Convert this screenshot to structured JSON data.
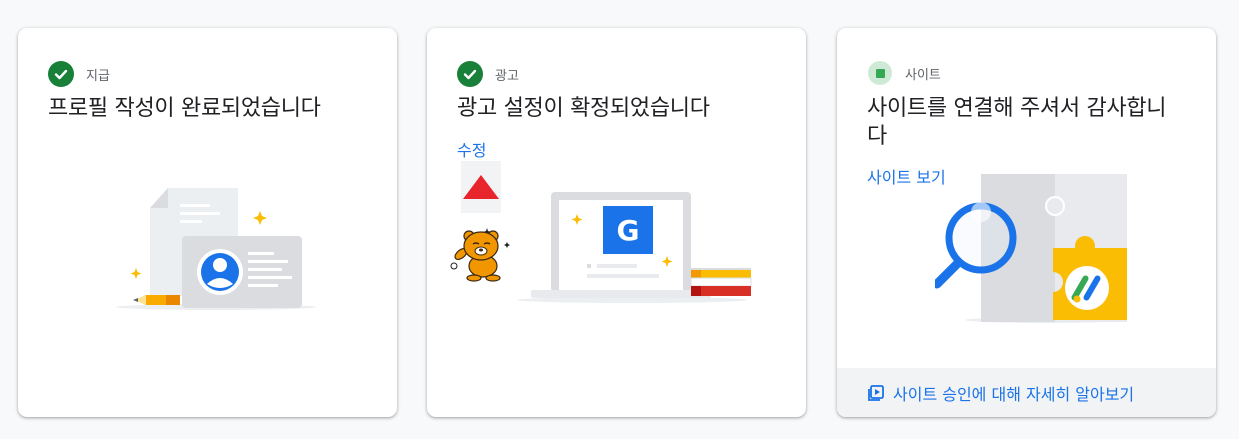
{
  "cards": [
    {
      "status_label": "지급",
      "title": "프로필 작성이 완료되었습니다",
      "status_icon": "check-circle-icon"
    },
    {
      "status_label": "광고",
      "title": "광고 설정이 확정되었습니다",
      "link": "수정",
      "status_icon": "check-circle-icon"
    },
    {
      "status_label": "사이트",
      "title": "사이트를 연결해 주셔서 감사합니다",
      "link": "사이트 보기",
      "footer_link": "사이트 승인에 대해 자세히 알아보기",
      "status_icon": "square-status-icon",
      "footer_icon": "video-library-icon"
    }
  ],
  "illustrations": {
    "google_badge_letter": "G"
  },
  "colors": {
    "accent_blue": "#1a73e8",
    "success_green": "#188038",
    "site_green": "#34a853",
    "footer_bg": "#f1f3f4"
  }
}
